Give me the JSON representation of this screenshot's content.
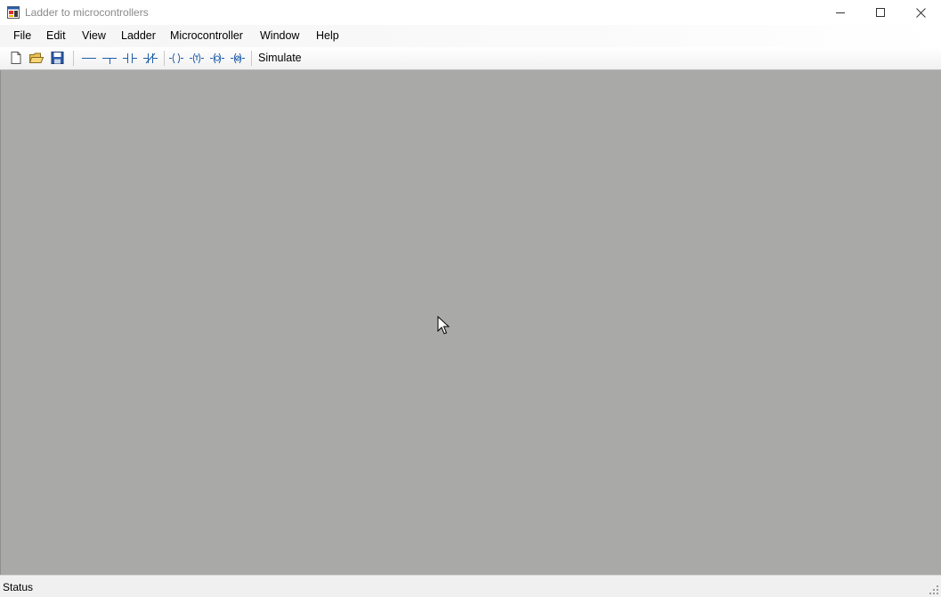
{
  "window": {
    "title": "Ladder to microcontrollers",
    "app_icon": "ladder-app-icon",
    "controls": [
      "minimize-icon",
      "maximize-icon",
      "close-icon"
    ]
  },
  "menu": {
    "items": [
      {
        "label": "File"
      },
      {
        "label": "Edit"
      },
      {
        "label": "View"
      },
      {
        "label": "Ladder"
      },
      {
        "label": "Microcontroller"
      },
      {
        "label": "Window"
      },
      {
        "label": "Help"
      }
    ]
  },
  "toolbar": {
    "icons": [
      "new-file-icon",
      "open-folder-icon",
      "save-icon",
      "wire-icon",
      "branch-icon",
      "contact-no-icon",
      "contact-nc-icon",
      "coil-icon",
      "coil-negated-icon",
      "coil-set-icon",
      "coil-reset-icon"
    ],
    "simulate_label": "Simulate"
  },
  "workspace": {
    "background": "#a9aaa8"
  },
  "status": {
    "text": "Status"
  },
  "colors": {
    "toolbar_icon": "#1f5ea8",
    "title_text": "#8a8a8a"
  }
}
